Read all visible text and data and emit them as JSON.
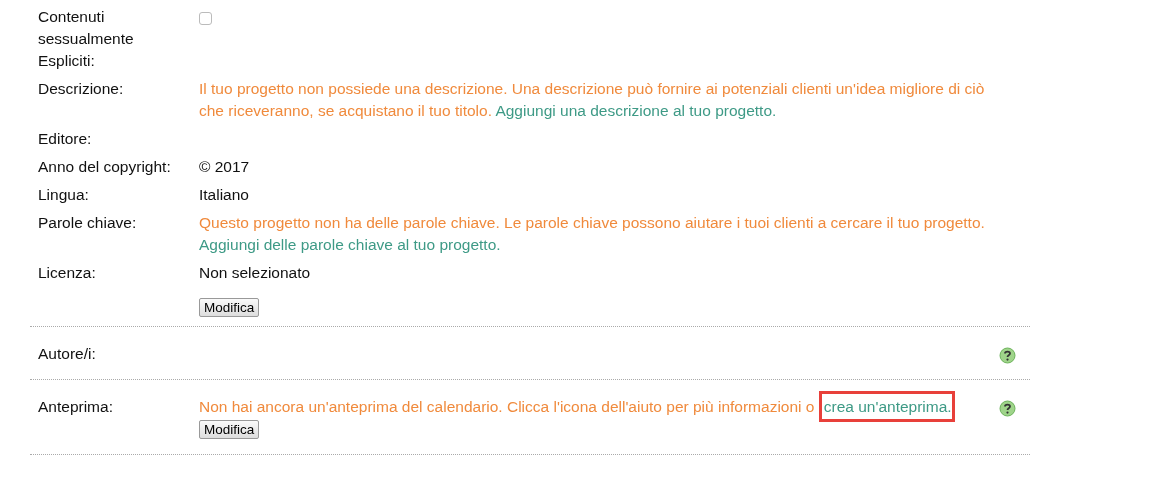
{
  "fields": [
    {
      "label": "Contenuti sessualmente Espliciti:",
      "kind": "checkbox",
      "checked": false
    },
    {
      "label": "Descrizione:",
      "kind": "notice",
      "text": "Il tuo progetto non possiede una descrizione. Una descrizione può fornire ai potenziali clienti un'idea migliore di ciò che riceveranno, se acquistano il tuo titolo.",
      "link": "Aggiungi una descrizione al tuo progetto.",
      "link_break": false
    },
    {
      "label": "Editore:",
      "kind": "empty"
    },
    {
      "label": "Anno del copyright:",
      "kind": "text",
      "value": "© 2017"
    },
    {
      "label": "Lingua:",
      "kind": "text",
      "value": "Italiano"
    },
    {
      "label": "Parole chiave:",
      "kind": "notice",
      "text": "Questo progetto non ha delle parole chiave. Le parole chiave possono aiutare i tuoi clienti a cercare il tuo progetto.",
      "link": "Aggiungi delle parole chiave al tuo progetto.",
      "link_break": true
    },
    {
      "label": "Licenza:",
      "kind": "text",
      "value": "Non selezionato"
    }
  ],
  "edit_button": "Modifica",
  "sections": [
    {
      "label": "Autore/i:",
      "help": true
    },
    {
      "label": "Anteprima:",
      "help": true,
      "text": "Non hai ancora un'anteprima del calendario. Clicca l'icona dell'aiuto per più informazioni o",
      "link": "crea un'anteprima.",
      "link_highlighted": true,
      "button": "Modifica"
    }
  ]
}
